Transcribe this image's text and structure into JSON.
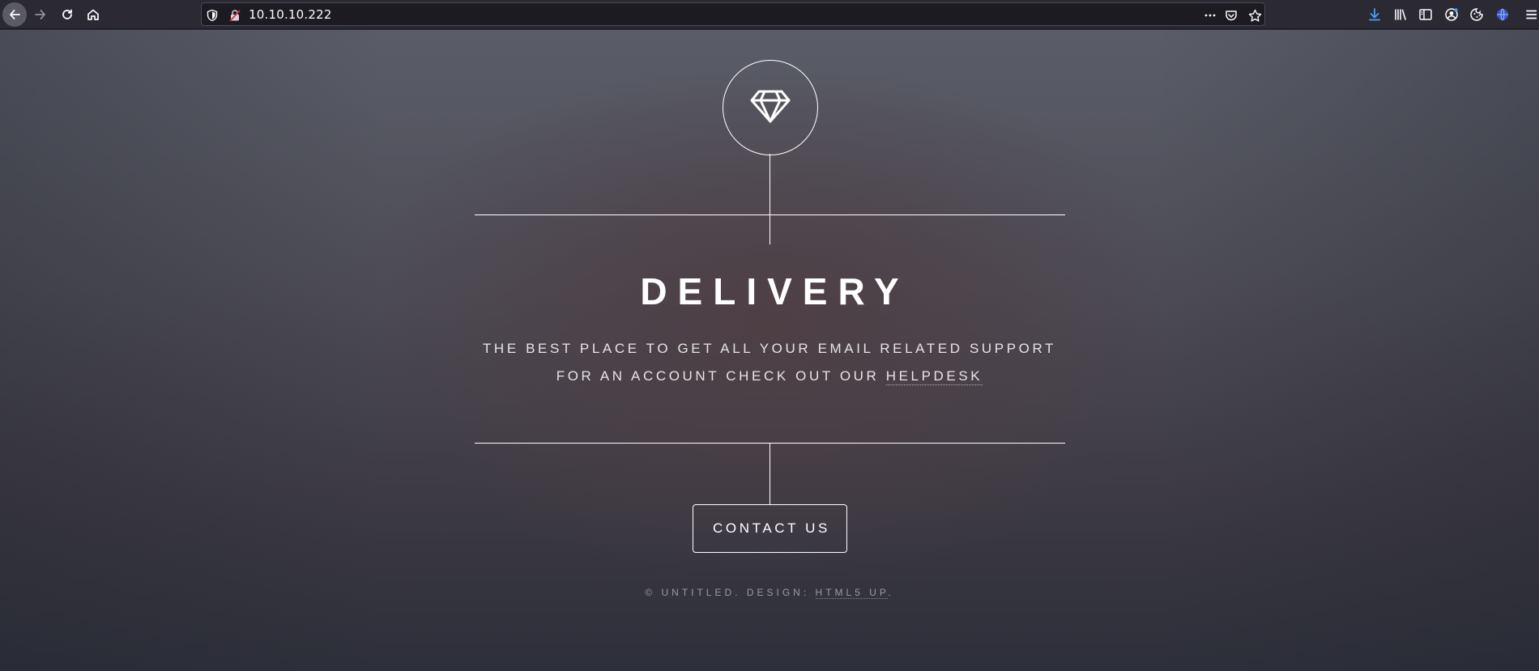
{
  "browser": {
    "url": "10.10.10.222",
    "icons": {
      "back": "back-arrow-icon",
      "forward": "forward-arrow-icon",
      "reload": "reload-icon",
      "home": "home-icon",
      "tracking_protection": "shield-icon",
      "site_identity": "insecure-lock-icon",
      "page_actions": "more-dots-icon",
      "pocket": "pocket-icon",
      "bookmark": "star-icon",
      "downloads": "download-icon",
      "library": "library-icon",
      "sidebar": "sidebar-icon",
      "account": "account-icon",
      "cookie_extension": "cookie-icon",
      "vpn_extension": "globe-icon",
      "menu": "hamburger-menu-icon"
    },
    "accent_color": "#45a1ff"
  },
  "page": {
    "logo_icon": "diamond-icon",
    "title": "DELIVERY",
    "subtitle_line1": "THE BEST PLACE TO GET ALL YOUR EMAIL RELATED SUPPORT",
    "subtitle_line2_prefix": "FOR AN ACCOUNT CHECK OUT OUR ",
    "helpdesk_link": "HELPDESK",
    "contact_button": "CONTACT US",
    "footer_prefix": "© UNTITLED. DESIGN: ",
    "footer_link": "HTML5 UP",
    "footer_suffix": "."
  }
}
